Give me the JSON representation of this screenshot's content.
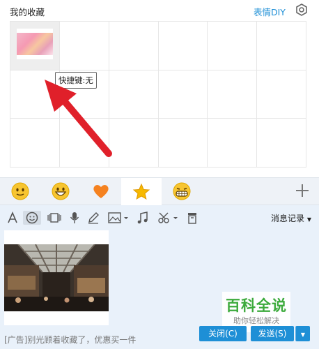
{
  "panel": {
    "title": "我的收藏",
    "diy_link": "表情DIY",
    "tooltip": "快捷键:无"
  },
  "emoji_tabs": [
    {
      "name": "smile"
    },
    {
      "name": "grin"
    },
    {
      "name": "heart"
    },
    {
      "name": "favorites-star",
      "selected": true
    },
    {
      "name": "laugh"
    }
  ],
  "toolbar": {
    "icons": [
      "font-icon",
      "emoji-icon",
      "screenshot-icon",
      "microphone-icon",
      "pen-icon",
      "image-icon",
      "music-icon",
      "scissors-icon",
      "trash-icon"
    ],
    "history_label": "消息记录"
  },
  "message": {
    "ad_text": "[广告]别光顾着收藏了，优惠买一件"
  },
  "buttons": {
    "close": "关闭(C)",
    "send": "发送(S)"
  },
  "watermark": {
    "title": "百科全说",
    "subtitle": "助你轻松解决"
  },
  "colors": {
    "accent": "#1e8fd6",
    "arrow": "#e0202a"
  }
}
